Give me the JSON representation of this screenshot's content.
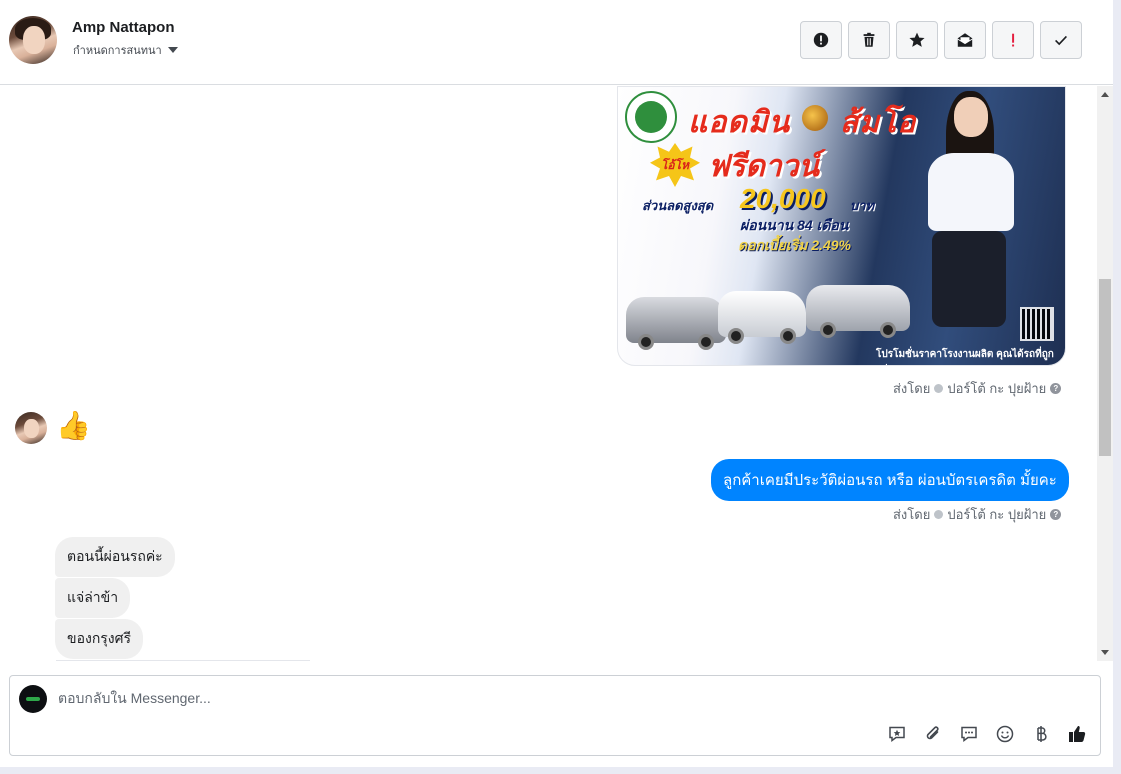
{
  "header": {
    "contact_name": "Amp Nattapon",
    "assign_label": "กำหนดการสนทนา",
    "tools": [
      {
        "icon": "alert-circle-icon",
        "label": "Spam"
      },
      {
        "icon": "trash-icon",
        "label": "Delete"
      },
      {
        "icon": "star-icon",
        "label": "Star"
      },
      {
        "icon": "mark-unread-icon",
        "label": "Mark as unread"
      },
      {
        "icon": "exclamation-icon",
        "label": "Follow up"
      },
      {
        "icon": "checkmark-icon",
        "label": "Done"
      }
    ]
  },
  "thread": {
    "promo": {
      "title": "แอดมิน",
      "title_2": "ส้มโอ",
      "badge": "โอ้โห",
      "free_down": "ฟรีดาวน์",
      "discount_label": "ส่วนลดสูงสุด",
      "discount_amount": "20,000",
      "currency": "บาท",
      "installments": "ผ่อนนาน 84 เดือน",
      "interest": "ดอกเบี้ยเริ่ม 2.49%",
      "footer": "โปรโมชั่นราคาโรงงานผลิต คุณได้รถที่ถูกกว่า"
    },
    "sent_by_1": {
      "prefix": "ส่งโดย",
      "name": "ปอร์โต้ กะ ปุยฝ้าย"
    },
    "reaction": "👍",
    "outgoing_message": "ลูกค้าเคยมีประวัติผ่อนรถ หรือ ผ่อนบัตรเครดิต มั้ยคะ",
    "sent_by_2": {
      "prefix": "ส่งโดย",
      "name": "ปอร์โต้ กะ ปุยฝ้าย"
    },
    "incoming_messages": [
      "ตอนนี้ผ่อนรถค่ะ",
      "แจ่ล่าข้า",
      "ของกรุงศรี"
    ]
  },
  "composer": {
    "placeholder": "ตอบกลับใน Messenger...",
    "actions": [
      "saved-reply-icon",
      "attachment-icon",
      "chat-bubble-icon",
      "emoji-icon",
      "baht-icon",
      "like-icon"
    ]
  },
  "colors": {
    "accent": "#0084ff",
    "incoming_bubble": "#f0f0f0",
    "brand_red": "#e52b1c",
    "exclamation_red": "#e41e3f"
  }
}
